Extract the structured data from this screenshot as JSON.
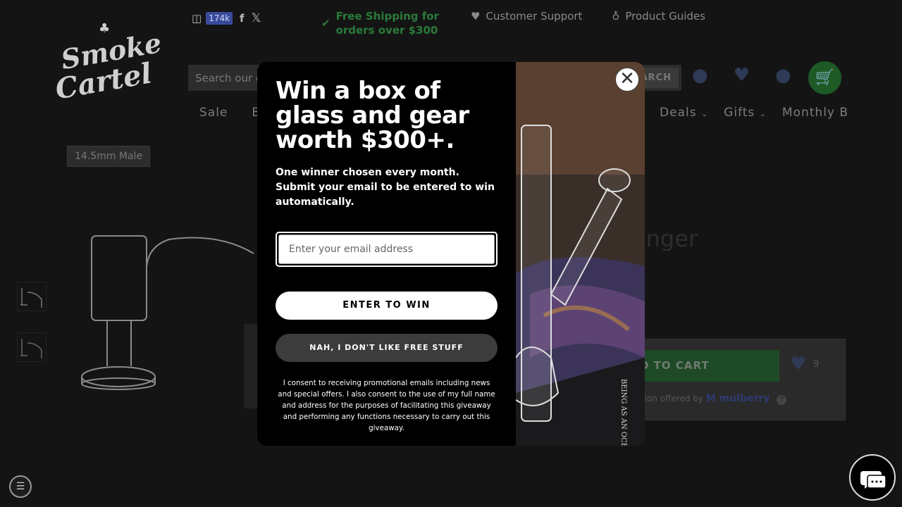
{
  "header": {
    "logo_line1": "Smoke",
    "logo_line2": "Cartel",
    "social_count": "174k",
    "shipping": "Free Shipping for orders over $300",
    "support": "Customer Support",
    "guides": "Product Guides",
    "search_placeholder": "Search our o",
    "search_button": "ARCH"
  },
  "nav": {
    "left": [
      "Sale",
      "Bo"
    ],
    "right": [
      "Deals",
      "Gifts",
      "Monthly B"
    ]
  },
  "product": {
    "tag": "14.5mm Male",
    "title_fragment": "anger",
    "add_to_cart": "D TO CART",
    "wishlist_count": "9",
    "protection_text": "ection offered by",
    "protection_brand": "mulberry"
  },
  "modal": {
    "headline": "Win a box of glass and gear worth $300+.",
    "subtext": "One winner chosen every month. Submit your email to be entered to win automatically.",
    "email_placeholder": "Enter your email address",
    "enter_button": "ENTER TO WIN",
    "decline_button": "NAH, I DON'T LIKE FREE STUFF",
    "consent": "I consent to receiving promotional emails including news and special offers. I also consent to the use of my full name and address for the purposes of facilitating this giveaway and performing any functions necessary to carry out this giveaway.",
    "image_text": "BEING AS AN OCEA"
  },
  "colors": {
    "accent_green": "#1d5a26",
    "ship_green": "#2a7a3a"
  }
}
